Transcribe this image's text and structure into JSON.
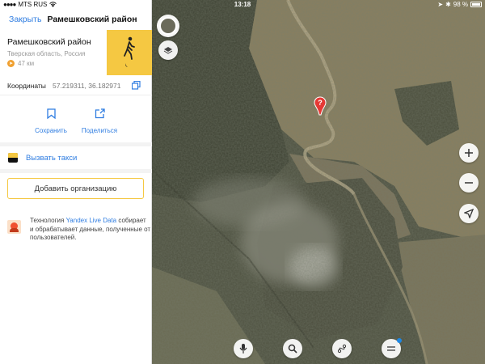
{
  "status_bar": {
    "carrier": "MTS RUS",
    "time": "13:18",
    "battery": "98 %"
  },
  "header": {
    "close_label": "Закрыть",
    "title": "Рамешковский район"
  },
  "place": {
    "name": "Рамешковский район",
    "region": "Тверская область, Россия",
    "distance": "47 км"
  },
  "coordinates": {
    "label": "Координаты",
    "value": "57.219311, 36.182971"
  },
  "actions": {
    "save_label": "Сохранить",
    "share_label": "Поделиться"
  },
  "taxi": {
    "label": "Вызвать такси"
  },
  "add_org": {
    "label": "Добавить организацию"
  },
  "live_data": {
    "prefix": "Технология ",
    "link": "Yandex Live Data",
    "suffix": " собирает и обрабатывает данные, полученные от пользователей."
  },
  "map": {
    "pin_label": "?"
  },
  "colors": {
    "accent_blue": "#2f7de1",
    "route_yellow": "#f5c842",
    "pin_red": "#e53935"
  }
}
